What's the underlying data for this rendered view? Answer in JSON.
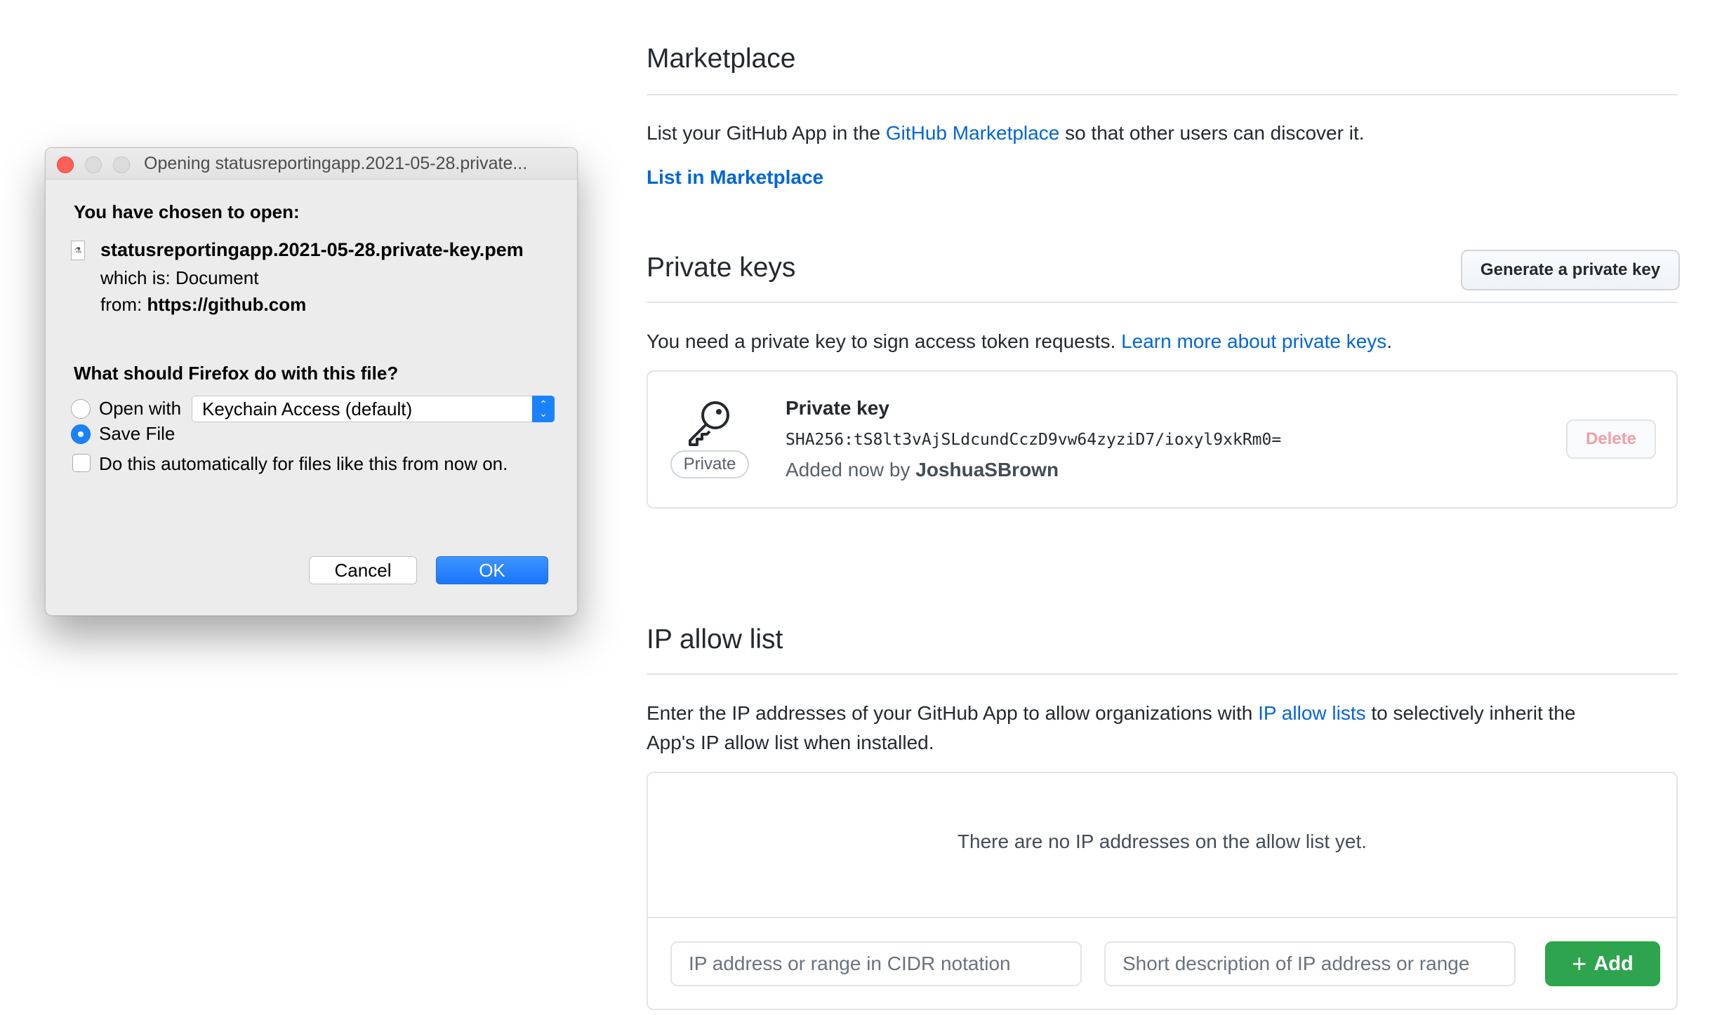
{
  "marketplace": {
    "title": "Marketplace",
    "desc_prefix": "List your GitHub App in the",
    "desc_link": "GitHub Marketplace",
    "desc_suffix": "so that other users can discover it.",
    "list_link": "List in Marketplace"
  },
  "private_keys": {
    "title": "Private keys",
    "generate_button": "Generate a private key",
    "desc_prefix": "You need a private key to sign access token requests.",
    "desc_link": "Learn more about private keys",
    "desc_suffix": ".",
    "key": {
      "icon": "key-icon",
      "label": "Private",
      "name": "Private key",
      "fingerprint": "SHA256:tS8lt3vAjSLdcundCczD9vw64zyziD7/ioxyl9xkRm0=",
      "added_prefix": "Added now by",
      "added_by": "JoshuaSBrown",
      "delete_button": "Delete"
    }
  },
  "ip_allow": {
    "title": "IP allow list",
    "desc_prefix": "Enter the IP addresses of your GitHub App to allow organizations with",
    "desc_link": "IP allow lists",
    "desc_suffix": "to selectively inherit the",
    "desc_line2": "App's IP allow list when installed.",
    "empty_message": "There are no IP addresses on the allow list yet.",
    "ip_placeholder": "IP address or range in CIDR notation",
    "desc_placeholder": "Short description of IP address or range",
    "add_button": "Add"
  },
  "dialog": {
    "title": "Opening statusreportingapp.2021-05-28.private...",
    "chosen_heading": "You have chosen to open:",
    "filename": "statusreportingapp.2021-05-28.private-key.pem",
    "which_is_label": "which is:",
    "which_is_value": "Document",
    "from_label": "from:",
    "from_value": "https://github.com",
    "question": "What should Firefox do with this file?",
    "open_with_label": "Open with",
    "open_with_app": "Keychain Access (default)",
    "save_file_label": "Save File",
    "selected_option": "Save File",
    "auto_label": "Do this automatically for files like this from now on.",
    "auto_checked": false,
    "cancel_button": "Cancel",
    "ok_button": "OK"
  },
  "colors": {
    "link": "#0366d6",
    "add_button": "#2ea44f",
    "mac_accent": "#1a82fb",
    "close_light": "#ff5f57"
  }
}
